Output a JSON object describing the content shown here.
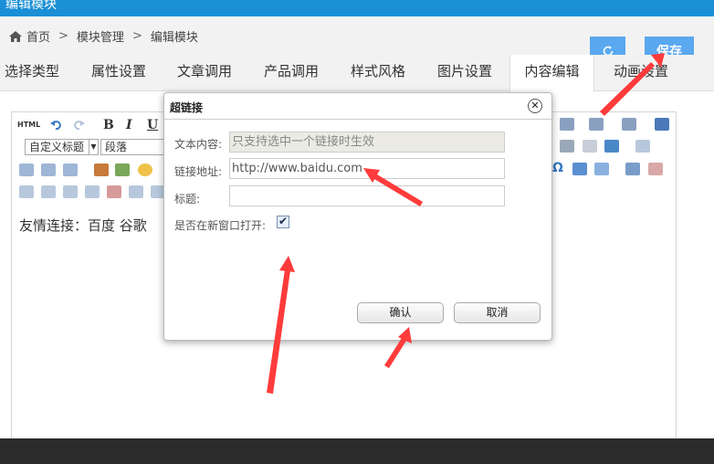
{
  "titlebar": {
    "title": "编辑模块"
  },
  "breadcrumb": {
    "home": "首页",
    "sep": ">",
    "module_mgmt": "模块管理",
    "edit_module": "编辑模块"
  },
  "actions": {
    "save": "保存"
  },
  "tabs": [
    {
      "label": "选择类型"
    },
    {
      "label": "属性设置"
    },
    {
      "label": "文章调用"
    },
    {
      "label": "产品调用"
    },
    {
      "label": "样式风格"
    },
    {
      "label": "图片设置"
    },
    {
      "label": "内容编辑"
    },
    {
      "label": "动画设置"
    }
  ],
  "editor": {
    "heading_select": "自定义标题",
    "paragraph_select": "段落",
    "html_btn": "HTML",
    "bold": "B",
    "italic": "I",
    "underline": "U",
    "omega": "Ω",
    "content": "友情连接：百度  谷歌"
  },
  "dialog": {
    "title": "超链接",
    "close": "✕",
    "text_label": "文本内容:",
    "text_value": "只支持选中一个链接时生效",
    "url_label": "链接地址:",
    "url_value": "http://www.baidu.com",
    "title_label": "标题:",
    "title_value": "",
    "newwin_label": "是否在新窗口打开:",
    "newwin_checked": "✔",
    "ok": "确认",
    "cancel": "取消"
  },
  "colors": {
    "accent": "#1a8fd6",
    "button": "#5aa8ef",
    "arrow": "#ff3b3b"
  }
}
